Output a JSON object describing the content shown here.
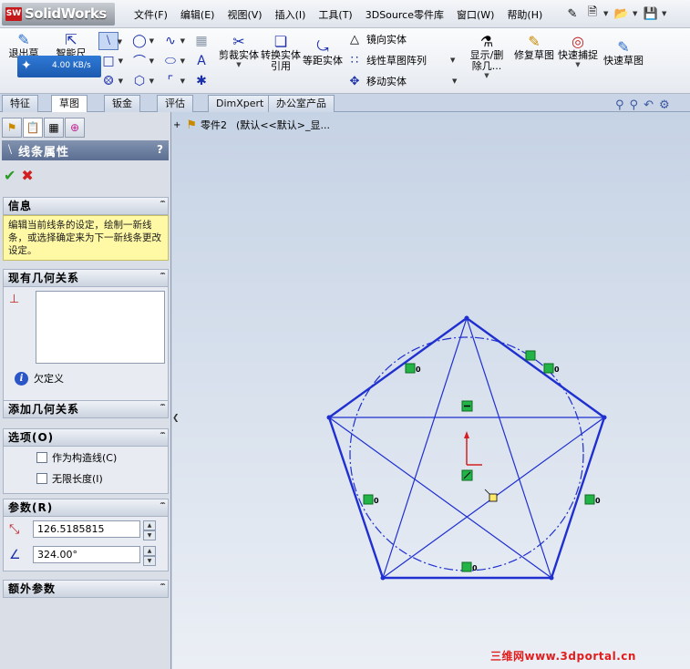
{
  "app": {
    "name": "SolidWorks",
    "badge": "SW"
  },
  "menu": [
    "文件(F)",
    "编辑(E)",
    "视图(V)",
    "插入(I)",
    "工具(T)",
    "3DSource零件库",
    "窗口(W)",
    "帮助(H)"
  ],
  "toolbar": {
    "exit_sketch": "退出草图",
    "smart_dimension": "智能尺寸",
    "trim": "剪裁实体",
    "convert": "转换实体引用",
    "offset": "等距实体",
    "mirror": "镜向实体",
    "linear_pattern": "线性草图阵列",
    "move": "移动实体",
    "show_delete": "显示/删除几...",
    "repair": "修复草图",
    "quick_snap": "快速捕捉",
    "rapid_sketch": "快速草图",
    "network_speed": "4.00 KB/s"
  },
  "tabs": [
    "特征",
    "草图",
    "钣金",
    "评估",
    "DimXpert",
    "办公室产品"
  ],
  "active_tab": "草图",
  "tree": {
    "part": "零件2",
    "config": "(默认<<默认>_显..."
  },
  "panel": {
    "title": "线条属性",
    "help": "?",
    "info": {
      "header": "信息",
      "message": "编辑当前线条的设定，绘制一新线条，或选择确定来为下一新线条更改设定。"
    },
    "existing_relations": {
      "header": "现有几何关系",
      "status": "欠定义"
    },
    "add_relations": {
      "header": "添加几何关系"
    },
    "options": {
      "header": "选项(O)",
      "construction": "作为构造线(C)",
      "infinite": "无限长度(I)"
    },
    "parameters": {
      "header": "参数(R)",
      "length": "126.5185815",
      "angle": "324.00°"
    },
    "additional": {
      "header": "额外参数"
    }
  },
  "sketch": {
    "relation_tag": "0",
    "line_color": "#1f2fd0",
    "highlight_color": "#23b447"
  },
  "watermark": "三维网www.3dportal.cn"
}
